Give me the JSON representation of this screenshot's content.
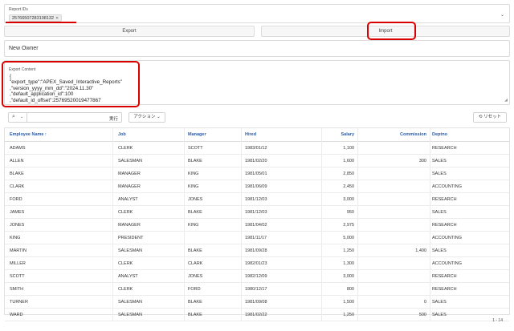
{
  "report_ids": {
    "label": "Report IDs",
    "selected_chip": "25766507283108132"
  },
  "buttons": {
    "export": "Export",
    "import": "Import"
  },
  "owner": {
    "value": "New Owner"
  },
  "export_content": {
    "label": "Export Content",
    "lines": [
      "{",
      "\"export_type\":\"APEX_Saved_Interactive_Reports\"",
      ",\"version_yyyy_mm_dd\":\"2024.11.30\"",
      ",\"default_application_id\":100",
      ",\"default_id_offset\":25769520019477867"
    ]
  },
  "toolbar": {
    "search_placeholder": "",
    "go_label": "実行",
    "actions_label": "アクション",
    "reset_label": "リセット"
  },
  "grid": {
    "columns": [
      "Employee Name",
      "Job",
      "Manager",
      "Hired",
      "Salary",
      "Commission",
      "Deptno"
    ],
    "sort_indicator": "↑",
    "rows": [
      [
        "ADAMS",
        "CLERK",
        "SCOTT",
        "1983/01/12",
        "1,100",
        "",
        "RESEARCH"
      ],
      [
        "ALLEN",
        "SALESMAN",
        "BLAKE",
        "1981/02/20",
        "1,600",
        "300",
        "SALES"
      ],
      [
        "BLAKE",
        "MANAGER",
        "KING",
        "1981/05/01",
        "2,850",
        "",
        "SALES"
      ],
      [
        "CLARK",
        "MANAGER",
        "KING",
        "1981/06/09",
        "2,450",
        "",
        "ACCOUNTING"
      ],
      [
        "FORD",
        "ANALYST",
        "JONES",
        "1981/12/03",
        "3,000",
        "",
        "RESEARCH"
      ],
      [
        "JAMES",
        "CLERK",
        "BLAKE",
        "1981/12/03",
        "950",
        "",
        "SALES"
      ],
      [
        "JONES",
        "MANAGER",
        "KING",
        "1981/04/02",
        "2,975",
        "",
        "RESEARCH"
      ],
      [
        "KING",
        "PRESIDENT",
        "",
        "1981/11/17",
        "5,000",
        "",
        "ACCOUNTING"
      ],
      [
        "MARTIN",
        "SALESMAN",
        "BLAKE",
        "1981/09/28",
        "1,250",
        "1,400",
        "SALES"
      ],
      [
        "MILLER",
        "CLERK",
        "CLARK",
        "1982/01/23",
        "1,300",
        "",
        "ACCOUNTING"
      ],
      [
        "SCOTT",
        "ANALYST",
        "JONES",
        "1982/12/09",
        "3,000",
        "",
        "RESEARCH"
      ],
      [
        "SMITH",
        "CLERK",
        "FORD",
        "1980/12/17",
        "800",
        "",
        "RESEARCH"
      ],
      [
        "TURNER",
        "SALESMAN",
        "BLAKE",
        "1981/09/08",
        "1,500",
        "0",
        "SALES"
      ],
      [
        "WARD",
        "SALESMAN",
        "BLAKE",
        "1981/02/22",
        "1,250",
        "500",
        "SALES"
      ]
    ],
    "pagination": "1 - 14"
  },
  "colors": {
    "accent": "#2c5ca4",
    "highlight": "#d90000"
  }
}
